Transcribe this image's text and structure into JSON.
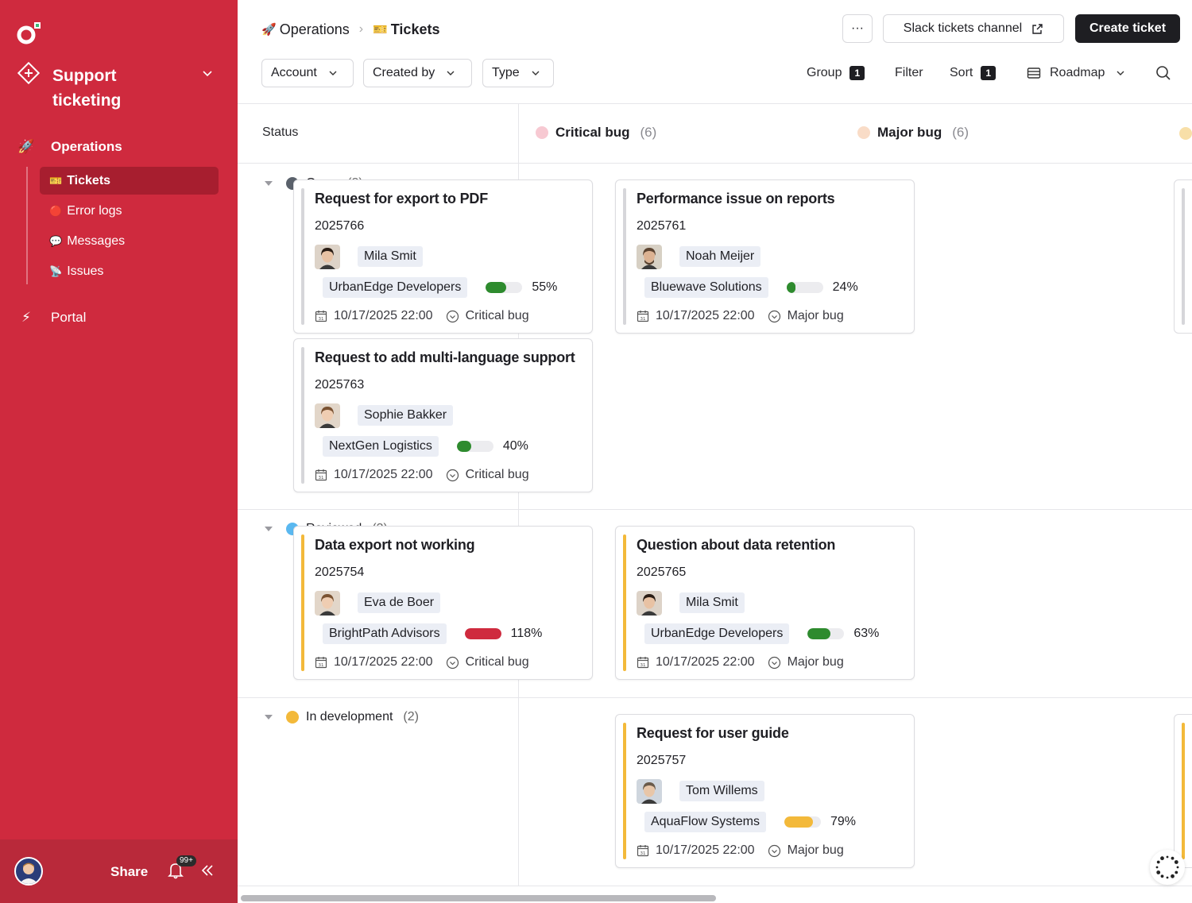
{
  "sidebar": {
    "workspace": "Support ticketing",
    "sections": [
      {
        "label": "Operations",
        "icon": "rocket-icon"
      },
      {
        "label": "Portal",
        "icon": "lightning-icon"
      }
    ],
    "subitems": [
      {
        "label": "Tickets",
        "icon": "ticket-icon",
        "emoji": "🎫"
      },
      {
        "label": "Error logs",
        "icon": "red-circle-icon",
        "emoji": "🔴"
      },
      {
        "label": "Messages",
        "icon": "speech-bubble-icon",
        "emoji": "💬"
      },
      {
        "label": "Issues",
        "icon": "satellite-icon",
        "emoji": "📡"
      }
    ],
    "footer": {
      "share": "Share",
      "notifications": "99+"
    }
  },
  "header": {
    "breadcrumb": [
      {
        "label": "Operations",
        "emoji": "🚀"
      },
      {
        "label": "Tickets",
        "emoji": "🎫"
      }
    ],
    "more": "···",
    "slack": "Slack tickets channel",
    "create": "Create ticket"
  },
  "toolbar": {
    "filters": [
      "Account",
      "Created by",
      "Type"
    ],
    "group": {
      "label": "Group",
      "count": "1"
    },
    "filter": "Filter",
    "sort": {
      "label": "Sort",
      "count": "1"
    },
    "view": "Roadmap"
  },
  "board": {
    "status_header": "Status",
    "columns": [
      {
        "name": "Critical bug",
        "count": "(6)",
        "color": "#f7c9d2"
      },
      {
        "name": "Major bug",
        "count": "(6)",
        "color": "#f9dcc7"
      }
    ],
    "groups": [
      {
        "name": "Open",
        "count": "(8)",
        "color": "#5a616b"
      },
      {
        "name": "Reviewed",
        "count": "(3)",
        "color": "#5ab8f0"
      },
      {
        "name": "In development",
        "count": "(2)",
        "color": "#f3b93a"
      }
    ],
    "cards": [
      {
        "title": "Request for export to PDF",
        "id": "2025766",
        "person": "Mila Smit",
        "account": "UrbanEdge Developers",
        "progress": 55,
        "progress_label": "55%",
        "progress_color": "#2e8b2e",
        "date": "10/17/2025 22:00",
        "type": "Critical bug",
        "bar_color": "#d6d6da",
        "face": "female-dark"
      },
      {
        "title": "Request to add multi-language support",
        "id": "2025763",
        "person": "Sophie Bakker",
        "account": "NextGen Logistics",
        "progress": 40,
        "progress_label": "40%",
        "progress_color": "#2e8b2e",
        "date": "10/17/2025 22:00",
        "type": "Critical bug",
        "bar_color": "#d6d6da",
        "face": "female-light"
      },
      {
        "title": "Performance issue on reports",
        "id": "2025761",
        "person": "Noah Meijer",
        "account": "Bluewave Solutions",
        "progress": 24,
        "progress_label": "24%",
        "progress_color": "#2e8b2e",
        "date": "10/17/2025 22:00",
        "type": "Major bug",
        "bar_color": "#d6d6da",
        "face": "male-beard"
      },
      {
        "title": "Data export not working",
        "id": "2025754",
        "person": "Eva de Boer",
        "account": "BrightPath Advisors",
        "progress": 100,
        "progress_label": "118%",
        "progress_color": "#cf2a3e",
        "date": "10/17/2025 22:00",
        "type": "Critical bug",
        "bar_color": "#f3b93a",
        "face": "female-light"
      },
      {
        "title": "Question about data retention",
        "id": "2025765",
        "person": "Mila Smit",
        "account": "UrbanEdge Developers",
        "progress": 63,
        "progress_label": "63%",
        "progress_color": "#2e8b2e",
        "date": "10/17/2025 22:00",
        "type": "Major bug",
        "bar_color": "#f3b93a",
        "face": "female-dark"
      },
      {
        "title": "Request for user guide",
        "id": "2025757",
        "person": "Tom Willems",
        "account": "AquaFlow Systems",
        "progress": 79,
        "progress_label": "79%",
        "progress_color": "#f3b93a",
        "date": "10/17/2025 22:00",
        "type": "Major bug",
        "bar_color": "#f3b93a",
        "face": "male-light"
      }
    ]
  }
}
